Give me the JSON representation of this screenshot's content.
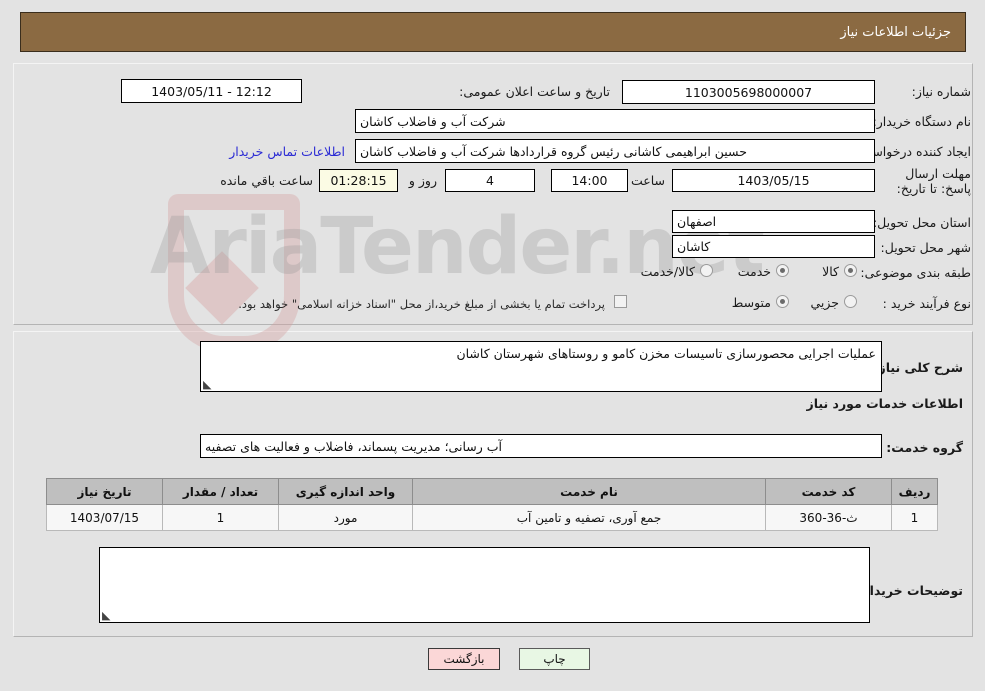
{
  "header": {
    "title": "جزئیات اطلاعات نیاز"
  },
  "top": {
    "need_number_label": "شماره نیاز:",
    "need_number_value": "1103005698000007",
    "announce_label": "تاریخ و ساعت اعلان عمومی:",
    "announce_value": "12:12 - 1403/05/11",
    "buyer_org_label": "نام دستگاه خریدار:",
    "buyer_org_value": "شرکت آب و فاضلاب کاشان",
    "creator_label": "ایجاد کننده درخواست:",
    "creator_value": "حسین ابراهیمی کاشانی رئیس گروه قراردادها شرکت آب و فاضلاب کاشان",
    "contact_link": "اطلاعات تماس خریدار",
    "deadline_label": "مهلت ارسال پاسخ: تا تاریخ:",
    "deadline_date": "1403/05/15",
    "time_label": "ساعت",
    "deadline_time": "14:00",
    "days_remaining": "4",
    "days_word": "روز و",
    "timer_value": "01:28:15",
    "remaining_word": "ساعت باقي مانده",
    "province_label": "استان محل تحویل:",
    "province_value": "اصفهان",
    "city_label": "شهر محل تحویل:",
    "city_value": "کاشان",
    "category_label": "طبقه بندی موضوعی:",
    "category_options": [
      {
        "label": "کالا",
        "selected": false
      },
      {
        "label": "خدمت",
        "selected": true
      },
      {
        "label": "کالا/خدمت",
        "selected": false
      }
    ],
    "process_label": "نوع فرآیند خرید :",
    "process_options": [
      {
        "label": "جزیي",
        "selected": false
      },
      {
        "label": "متوسط",
        "selected": true
      }
    ],
    "treasury_checkbox_checked": false,
    "treasury_note": "پرداخت تمام یا بخشی از مبلغ خرید،از محل \"اسناد خزانه اسلامی\" خواهد بود."
  },
  "bottom": {
    "general_desc_label": "شرح کلی نیاز:",
    "general_desc_value": "عملیات اجرایی محصورسازی تاسیسات مخزن کامو و روستاهای شهرستان کاشان",
    "services_section_title": "اطلاعات خدمات مورد نیاز",
    "service_group_label": "گروه خدمت:",
    "service_group_value": "آب رسانی؛ مدیریت پسماند، فاضلاب و فعالیت های تصفیه",
    "table": {
      "headers": [
        "ردیف",
        "کد خدمت",
        "نام خدمت",
        "واحد اندازه گیری",
        "تعداد / مقدار",
        "تاریخ نیاز"
      ],
      "rows": [
        [
          "1",
          "ث-36-360",
          "جمع آوری، تصفیه و تامین آب",
          "مورد",
          "1",
          "1403/07/15"
        ]
      ]
    },
    "buyer_notes_label": "توضیحات خریدار:",
    "buyer_notes_value": ""
  },
  "footer": {
    "print_label": "چاپ",
    "back_label": "بازگشت"
  },
  "watermark": {
    "text": "AriaTender.net"
  },
  "colors": {
    "header_brown": "#8b6a42",
    "page_bg": "#e3e3e3",
    "link_blue": "#2b2bd4",
    "timer_bg": "#fbfbe4",
    "print_bg": "#e8f7e4",
    "back_bg": "#fbd7d7",
    "table_header_bg": "#bfbfbf"
  }
}
